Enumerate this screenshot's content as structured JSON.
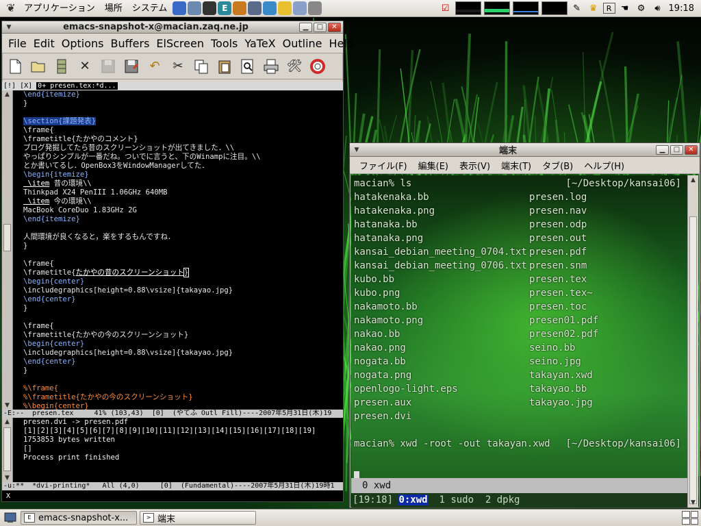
{
  "top_panel": {
    "menus": [
      "アプリケーション",
      "場所",
      "システム"
    ],
    "launchers": [
      {
        "icon": "firefox-icon",
        "color": "#3a6ac8"
      },
      {
        "icon": "mail-icon",
        "color": "#6a8ab0"
      },
      {
        "icon": "terminal-icon",
        "color": "#333333"
      },
      {
        "icon": "emacs-icon",
        "glyph": "E",
        "color": "#2a8a9a"
      },
      {
        "icon": "butterfly-icon",
        "color": "#c87a20"
      },
      {
        "icon": "gimp-icon",
        "color": "#5a6a8a"
      },
      {
        "icon": "compass-icon",
        "color": "#3a8ac8"
      },
      {
        "icon": "notes-icon",
        "color": "#e8c030"
      },
      {
        "icon": "image-viewer-icon",
        "color": "#8aa0c8"
      },
      {
        "icon": "magnifier-icon",
        "color": "#888888"
      }
    ],
    "clock": "19:18"
  },
  "emacs": {
    "title": "emacs-snapshot-x@macian.zaq.ne.jp",
    "menus": [
      "File",
      "Edit",
      "Options",
      "Buffers",
      "ElScreen",
      "Tools",
      "YaTeX",
      "Outline",
      "Help"
    ],
    "tabline": {
      "prefix": "[!] [X] ",
      "active": "0+ presen.tex:*d..."
    },
    "lines": [
      [
        {
          "t": "\\end{itemize}",
          "c": "kw"
        }
      ],
      [
        {
          "t": "}"
        }
      ],
      [
        {
          "t": ""
        }
      ],
      [
        {
          "t": "\\section{課題発表}",
          "c": "sect"
        }
      ],
      [
        {
          "t": "\\frame{"
        }
      ],
      [
        {
          "t": "\\frametitle{たかやのコメント}"
        }
      ],
      [
        {
          "t": "ブログ発掘してたら昔のスクリーンショットが出てきました．\\\\"
        }
      ],
      [
        {
          "t": "やっぱりシンプルが一番だね。ついでに言うと、下のWinampに注目。\\\\"
        }
      ],
      [
        {
          "t": "とか書いてるし．OpenBox3をWindowManagerしてた．"
        }
      ],
      [
        {
          "t": "\\begin{itemize}",
          "c": "kw"
        }
      ],
      [
        {
          "t": " \\item",
          "c": "kw under"
        },
        {
          "t": " 昔の環境\\\\"
        }
      ],
      [
        {
          "t": "Thinkpad X24 PenIII 1.06GHz 640MB"
        }
      ],
      [
        {
          "t": " \\item",
          "c": "kw under"
        },
        {
          "t": " 今の環境\\\\"
        }
      ],
      [
        {
          "t": "MacBook CoreDuo 1.83GHz 2G"
        }
      ],
      [
        {
          "t": "\\end{itemize}",
          "c": "kw"
        }
      ],
      [
        {
          "t": ""
        }
      ],
      [
        {
          "t": "人間環境が良くなると，楽をするもんですね．"
        }
      ],
      [
        {
          "t": "}"
        }
      ],
      [
        {
          "t": ""
        }
      ],
      [
        {
          "t": "\\frame{"
        }
      ],
      [
        {
          "t": "\\frametitle{"
        },
        {
          "t": "たかやの昔のスクリーンショット",
          "c": "under"
        },
        {
          "t": "}",
          "c": "cur"
        }
      ],
      [
        {
          "t": "\\begin{center}",
          "c": "kw"
        }
      ],
      [
        {
          "t": "\\includegraphics[height=0.88\\vsize]{takayao.jpg}"
        }
      ],
      [
        {
          "t": "\\end{center}",
          "c": "kw"
        }
      ],
      [
        {
          "t": "}"
        }
      ],
      [
        {
          "t": ""
        }
      ],
      [
        {
          "t": "\\frame{"
        }
      ],
      [
        {
          "t": "\\frametitle{たかやの今のスクリーンショット}"
        }
      ],
      [
        {
          "t": "\\begin{center}",
          "c": "kw"
        }
      ],
      [
        {
          "t": "\\includegraphics[height=0.88\\vsize]{takayao.jpg}"
        }
      ],
      [
        {
          "t": "\\end{center}",
          "c": "kw"
        }
      ],
      [
        {
          "t": "}"
        }
      ],
      [
        {
          "t": ""
        }
      ],
      [
        {
          "t": "%\\frame{",
          "c": "cmt"
        }
      ],
      [
        {
          "t": "%\\frametitle{たかやの今のスクリーンショット}",
          "c": "cmt"
        }
      ],
      [
        {
          "t": "%\\begin{center}",
          "c": "cmt"
        }
      ]
    ],
    "modeline_top": "-E:--  presen.tex     41% (103,43)  [0]  (やてふ Outl Fill)----2007年5月31日(木)19",
    "modeline_top_buffer": "presen.tex",
    "output_lines": [
      "presen.dvi -> presen.pdf",
      "[1][2][3][4][5][6][7][8][9][10][11][12][13][14][15][16][17][18][19]",
      "1753853 bytes written",
      "[]",
      "Process print finished"
    ],
    "modeline_bottom": "-u:**  *dvi-printing*   All (4,0)     [0]  (Fundamental)----2007年5月31日(木)19時1",
    "modeline_bottom_buffer": "*dvi-printing*"
  },
  "terminal": {
    "title": "端末",
    "menus": [
      "ファイル(F)",
      "編集(E)",
      "表示(V)",
      "端末(T)",
      "タブ(B)",
      "ヘルプ(H)"
    ],
    "prompt1": "macian% ls",
    "cwd": "[~/Desktop/kansai06]",
    "left_files": [
      "hatakenaka.bb",
      "hatakenaka.png",
      "hatanaka.bb",
      "hatanaka.png",
      "kansai_debian_meeting_0704.txt",
      "kansai_debian_meeting_0706.txt",
      "kubo.bb",
      "kubo.png",
      "nakamoto.bb",
      "nakamoto.png",
      "nakao.bb",
      "nakao.png",
      "nogata.bb",
      "nogata.png",
      "openlogo-light.eps",
      "presen.aux",
      "presen.dvi"
    ],
    "right_files": [
      "presen.log",
      "presen.nav",
      "presen.odp",
      "presen.out",
      "presen.pdf",
      "presen.snm",
      "presen.tex",
      "presen.tex~",
      "presen.toc",
      "presen01.pdf",
      "presen02.pdf",
      "seino.bb",
      "seino.jpg",
      "takayan.xwd",
      "takayao.bb",
      "takayao.jpg"
    ],
    "prompt2": "macian% xwd -root -out takayan.xwd",
    "screen_status": "0 xwd",
    "screen_tabs": {
      "time": "[19:18]",
      "current": "0:xwd",
      "others": "  1 sudo  2 dpkg"
    }
  },
  "bottom_panel": {
    "tasks": [
      {
        "label": "emacs-snapshot-x...",
        "active": true
      },
      {
        "label": "端末",
        "active": false
      }
    ]
  }
}
